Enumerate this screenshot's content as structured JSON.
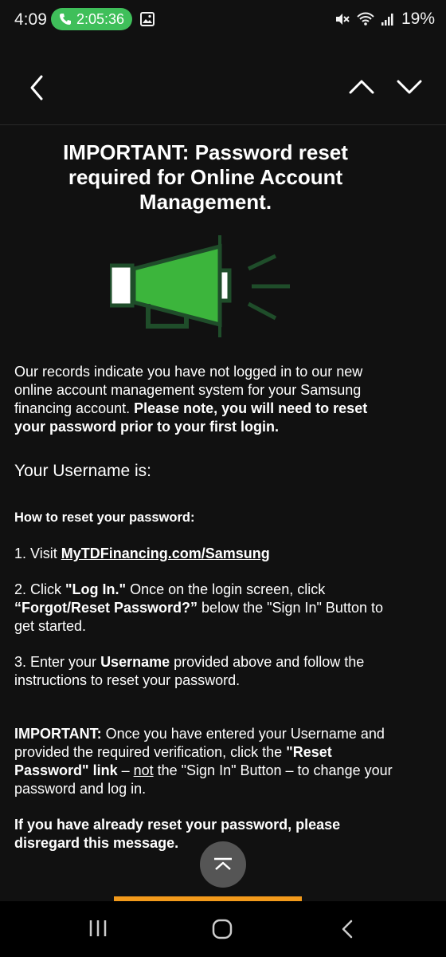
{
  "status_bar": {
    "time": "4:09",
    "call_duration": "2:05:36",
    "battery": "19%"
  },
  "header": {
    "back_icon": "chevron-left-icon",
    "prev_icon": "chevron-up-icon",
    "next_icon": "chevron-down-icon"
  },
  "email": {
    "title": "IMPORTANT: Password reset required for Online Account Management.",
    "intro_text": "Our records indicate you have not logged in to our new online account management system for your Samsung financing account. ",
    "intro_bold": "Please note, you will need to reset your password prior to your first login.",
    "username_label": "Your Username is:",
    "howto_heading": "How to reset your password:",
    "step1_prefix": "1. Visit ",
    "step1_link": "MyTDFinancing.com/Samsung",
    "step2_prefix": "2. Click ",
    "step2_bold1": "\"Log In.\"",
    "step2_mid": " Once on the login screen, click ",
    "step2_bold2": "“Forgot/Reset Password?”",
    "step2_suffix": " below the \"Sign In\" Button to get started.",
    "step3_prefix": "3. Enter your ",
    "step3_bold": "Username",
    "step3_suffix": " provided above and follow the instructions to reset your password.",
    "important_label": "IMPORTANT:",
    "important_text1": " Once you have entered your Username and provided the required verification, click the ",
    "important_bold": "\"Reset Password\" link",
    "important_text2": " – ",
    "important_not": "not",
    "important_text3": " the \"Sign In\" Button – to change your password and log in.",
    "disregard": "If you have already reset your password, please disregard this message."
  },
  "colors": {
    "background": "#111111",
    "megaphone_green": "#3cb53c",
    "megaphone_dark": "#1f4d2a",
    "call_pill": "#3fbf5a",
    "orange_button": "#f29a1b"
  }
}
